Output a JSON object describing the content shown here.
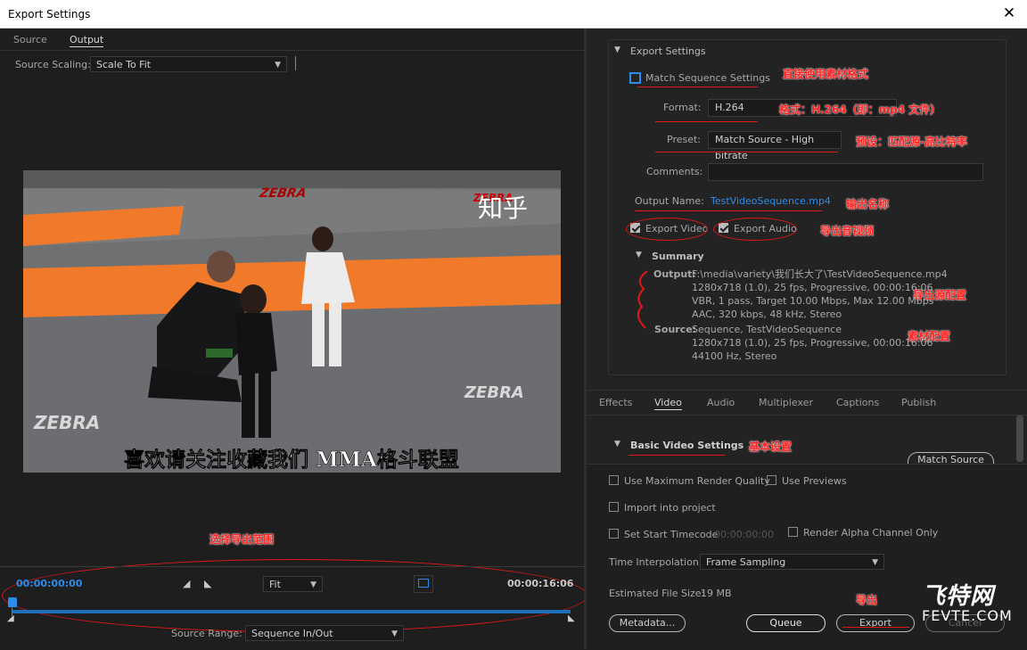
{
  "window": {
    "title": "Export Settings",
    "close_icon": "close-icon"
  },
  "left": {
    "tabs": [
      "Source",
      "Output"
    ],
    "source_scaling_label": "Source Scaling:",
    "source_scaling_value": "Scale To Fit",
    "video": {
      "watermark": "知乎",
      "subtitle": "喜欢请关注收藏我们 MMA格斗联盟",
      "banner_text": "ZEBRA"
    },
    "annotation_range": "选择导出范围",
    "timeline": {
      "start_time": "00:00:00:00",
      "end_time": "00:00:16:06",
      "zoom_value": "Fit",
      "source_range_label": "Source Range:",
      "source_range_value": "Sequence In/Out"
    }
  },
  "export_settings": {
    "header": "Export Settings",
    "match_sequence_label": "Match Sequence Settings",
    "format_label": "Format:",
    "format_value": "H.264",
    "preset_label": "Preset:",
    "preset_value": "Match Source - High bitrate",
    "comments_label": "Comments:",
    "comments_value": "",
    "output_name_label": "Output Name:",
    "output_name_value": "TestVideoSequence.mp4",
    "export_video_label": "Export Video",
    "export_audio_label": "Export Audio",
    "summary_header": "Summary",
    "output_label": "Output:",
    "output_lines": [
      "F:\\media\\variety\\我们长大了\\TestVideoSequence.mp4",
      "1280x718 (1.0), 25 fps, Progressive, 00:00:16:06",
      "VBR, 1 pass, Target 10.00 Mbps, Max 12.00 Mbps",
      "AAC, 320 kbps, 48 kHz, Stereo"
    ],
    "source_label": "Source:",
    "source_lines": [
      "Sequence, TestVideoSequence",
      "1280x718 (1.0), 25 fps, Progressive, 00:00:16:06",
      "44100 Hz, Stereo"
    ]
  },
  "annotations": {
    "match": "直接使用素材格式",
    "format": "格式：H.264（即：mp4 文件）",
    "preset": "预设：匹配源-高比特率",
    "output_name": "输出名称",
    "export_av": "导出音视频",
    "output_config": "导出源配置",
    "source_config": "素材配置",
    "basic": "基本设置",
    "export": "导出"
  },
  "settings_tabs": [
    "Effects",
    "Video",
    "Audio",
    "Multiplexer",
    "Captions",
    "Publish"
  ],
  "basic_video": {
    "header": "Basic Video Settings",
    "match_source_button": "Match Source"
  },
  "bottom": {
    "use_max_render": "Use Maximum Render Quality",
    "use_previews": "Use Previews",
    "import_into_project": "Import into project",
    "set_start_timecode": "Set Start Timecode",
    "start_timecode_value": "00:00:00:00",
    "render_alpha": "Render Alpha Channel Only",
    "time_interpolation_label": "Time Interpolation:",
    "time_interpolation_value": "Frame Sampling",
    "estimated_size_label": "Estimated File Size:",
    "estimated_size_value": "19 MB",
    "metadata_button": "Metadata...",
    "queue_button": "Queue",
    "export_button": "Export",
    "cancel_button": "Cancel"
  },
  "logo": {
    "text_cn": "飞特网",
    "text_en": "FEVTE.COM"
  },
  "colors": {
    "accent_blue": "#2d8ceb",
    "timeline_bar": "#1d6fb8",
    "annotation_red": "#e01818",
    "mat_orange": "#f07a2a"
  }
}
